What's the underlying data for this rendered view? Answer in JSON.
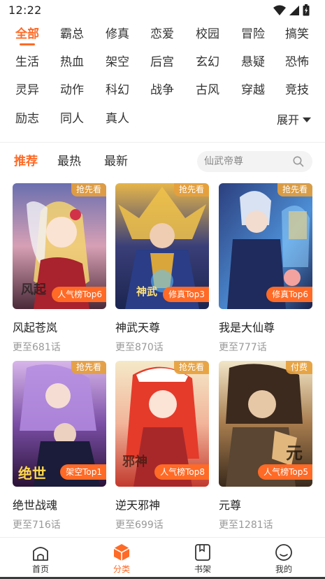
{
  "status_bar": {
    "time": "12:22",
    "icons": [
      "wifi-icon",
      "signal-icon",
      "battery-icon"
    ]
  },
  "genres": [
    "全部",
    "霸总",
    "修真",
    "恋爱",
    "校园",
    "冒险",
    "搞笑",
    "生活",
    "热血",
    "架空",
    "后宫",
    "玄幻",
    "悬疑",
    "恐怖",
    "灵异",
    "动作",
    "科幻",
    "战争",
    "古风",
    "穿越",
    "竞技",
    "励志",
    "同人",
    "真人"
  ],
  "genre_selected": "全部",
  "expand_label": "展开",
  "sort_tabs": [
    "推荐",
    "最热",
    "最新"
  ],
  "sort_selected": "推荐",
  "search": {
    "placeholder": "仙武帝尊"
  },
  "comics": [
    {
      "title": "风起苍岚",
      "update": "更至681话",
      "tag": "抢先看",
      "rank": "人气榜Top6"
    },
    {
      "title": "神武天尊",
      "update": "更至870话",
      "tag": "抢先看",
      "rank": "修真Top3"
    },
    {
      "title": "我是大仙尊",
      "update": "更至777话",
      "tag": "抢先看",
      "rank": "修真Top6"
    },
    {
      "title": "绝世战魂",
      "update": "更至716话",
      "tag": "抢先看",
      "rank": "架空Top1"
    },
    {
      "title": "逆天邪神",
      "update": "更至699话",
      "tag": "抢先看",
      "rank": "人气榜Top8"
    },
    {
      "title": "元尊",
      "update": "更至1281话",
      "tag": "付费",
      "rank": "人气榜Top5"
    }
  ],
  "bottom_nav": [
    {
      "label": "首页",
      "icon": "home-icon"
    },
    {
      "label": "分类",
      "icon": "category-cube-icon"
    },
    {
      "label": "书架",
      "icon": "bookshelf-icon"
    },
    {
      "label": "我的",
      "icon": "profile-icon"
    }
  ],
  "bottom_nav_selected": "分类",
  "colors": {
    "accent": "#ff6a26",
    "tag": "#e6a03c",
    "muted": "#999999"
  }
}
